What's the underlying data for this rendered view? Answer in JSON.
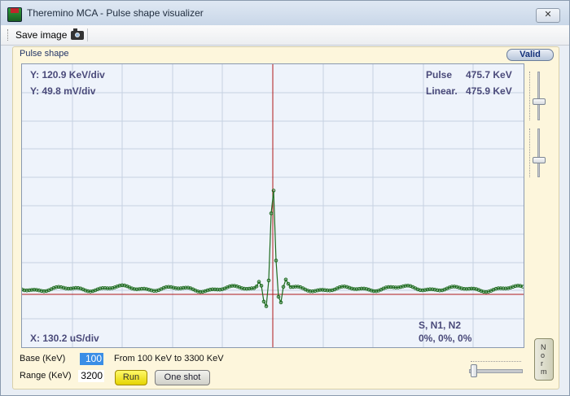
{
  "window": {
    "title": "Theremino MCA - Pulse shape visualizer",
    "close_label": "✕"
  },
  "toolbar": {
    "save_label": "Save image"
  },
  "panel": {
    "label": "Pulse shape",
    "valid_label": "Valid"
  },
  "plot": {
    "y_scale_1": "Y: 120.9 KeV/div",
    "y_scale_2": "Y: 49.8 mV/div",
    "x_scale": "X: 130.2 uS/div",
    "pulse_label": "Pulse",
    "pulse_value": "475.7 KeV",
    "linear_label": "Linear.",
    "linear_value": "475.9 KeV",
    "sn_header": "S,   N1,  N2",
    "sn_values": "0%, 0%, 0%"
  },
  "norm_button": {
    "letters": [
      "N",
      "o",
      "r",
      "m"
    ]
  },
  "controls": {
    "base_label": "Base (KeV)",
    "base_value": "100",
    "range_label": "Range (KeV)",
    "range_value": "3200",
    "range_info": "From 100 KeV to 3300 KeV",
    "run_label": "Run",
    "oneshot_label": "One shot"
  },
  "colors": {
    "trace": "#1e6b1e",
    "crosshair": "#b01818",
    "grid": "#c6d1e2"
  }
}
